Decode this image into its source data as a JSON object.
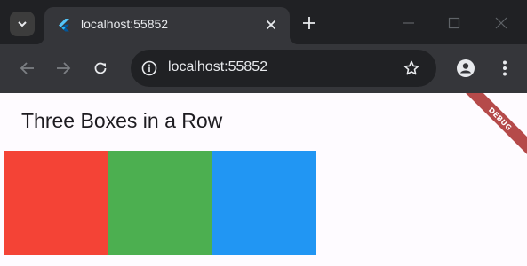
{
  "browser": {
    "tab": {
      "title": "localhost:55852"
    },
    "address_bar": {
      "url": "localhost:55852"
    }
  },
  "icons": {
    "tab_search": "chevron-down-icon",
    "favicon": "flutter-logo-icon",
    "tab_close": "close-icon",
    "new_tab": "plus-icon",
    "minimize": "minimize-icon",
    "maximize": "maximize-icon",
    "window_close": "close-icon",
    "back": "arrow-left-icon",
    "forward": "arrow-right-icon",
    "reload": "reload-icon",
    "site_info": "info-icon",
    "bookmark": "star-icon",
    "profile": "person-icon",
    "menu": "kebab-menu-icon"
  },
  "app": {
    "title": "Three Boxes in a Row",
    "boxes": [
      {
        "color": "#f44336"
      },
      {
        "color": "#4caf50"
      },
      {
        "color": "#2196f3"
      }
    ],
    "debug_label": "DEBUG",
    "debug_color": "#b54a4a"
  }
}
